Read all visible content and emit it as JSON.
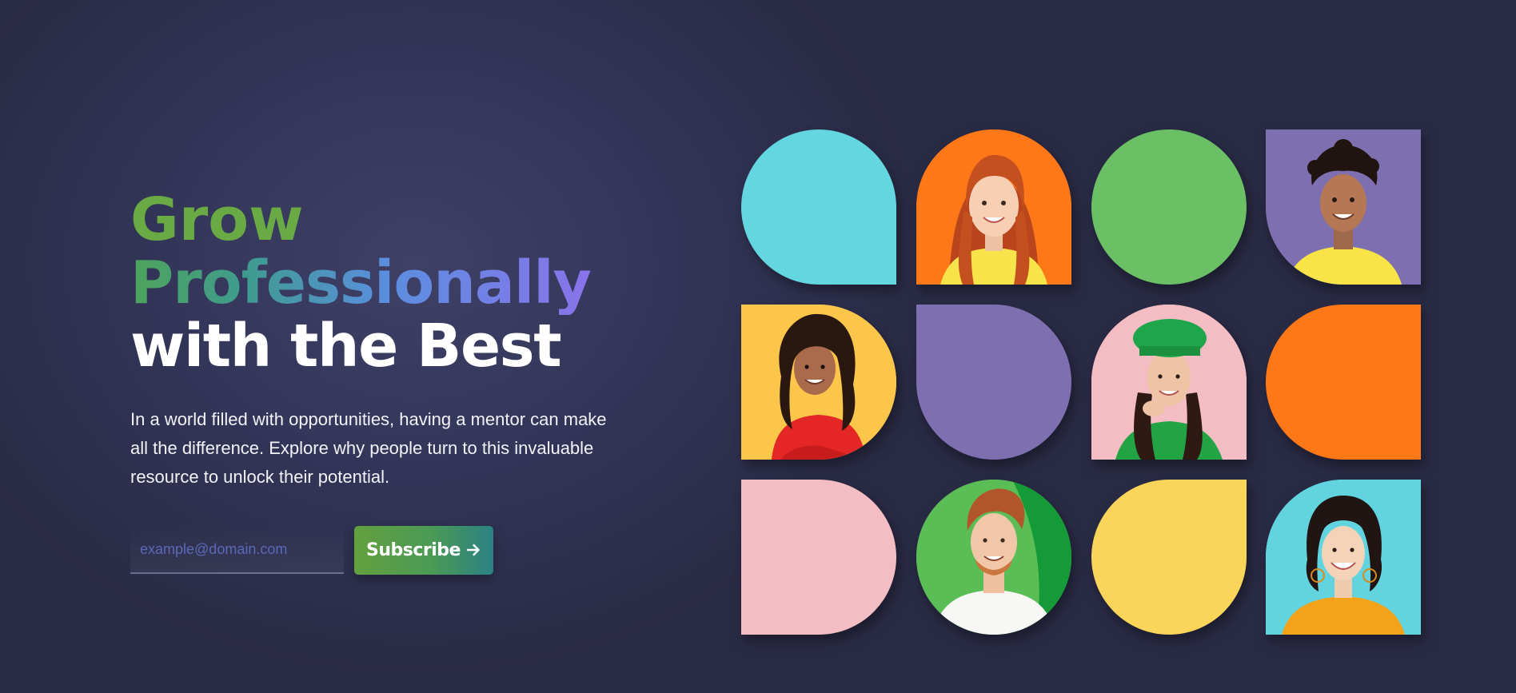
{
  "hero": {
    "headline_line1": "Grow",
    "headline_line2": "Professionally",
    "headline_line3": "with the Best",
    "intro": "In a world filled with opportunities, having a mentor can make all the difference. Explore why people turn to this invaluable resource to unlock their potential."
  },
  "subscribe": {
    "email_placeholder": "example@domain.com",
    "email_value": "",
    "button_label": "Subscribe"
  },
  "colors": {
    "background": "#292a44",
    "green": "#6aaa44",
    "cyan": "#64d6e0",
    "orange": "#ff7818",
    "lime": "#6bc066",
    "purple": "#7e6fb0",
    "yellow": "#fbd55a",
    "pink": "#f4bdc3"
  },
  "mosaic": {
    "tiles": [
      {
        "kind": "color",
        "color": "#64d6e0"
      },
      {
        "kind": "photo",
        "bg": "#ff7818",
        "subject": "red-haired woman in yellow top"
      },
      {
        "kind": "color",
        "color": "#6bc066"
      },
      {
        "kind": "photo",
        "bg": "#7e6fb0",
        "subject": "young man with curly hair in yellow shirt"
      },
      {
        "kind": "photo",
        "bg": "#fcc64a",
        "subject": "curly-haired woman in red sweater"
      },
      {
        "kind": "color",
        "color": "#7e6fb0"
      },
      {
        "kind": "photo",
        "bg": "#f4bdc3",
        "subject": "woman in green beret"
      },
      {
        "kind": "color",
        "color": "#ff7818"
      },
      {
        "kind": "color",
        "color": "#f4bdc3"
      },
      {
        "kind": "photo",
        "bg": "#5bbd56",
        "subject": "red-haired man in white t-shirt"
      },
      {
        "kind": "color",
        "color": "#fbd55a"
      },
      {
        "kind": "photo",
        "bg": "#62d4e0",
        "subject": "smiling woman in yellow top"
      }
    ]
  }
}
